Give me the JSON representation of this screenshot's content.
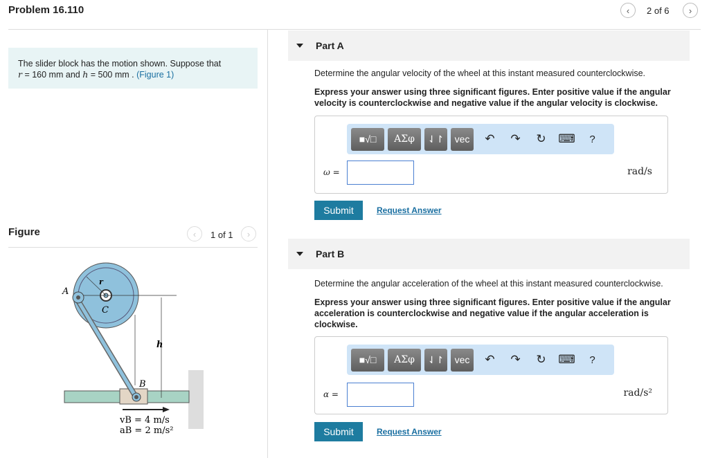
{
  "header": {
    "title": "Problem 16.110",
    "pager": "2 of 6",
    "prev_icon": "chevron-left-icon",
    "next_icon": "chevron-right-icon"
  },
  "problem": {
    "text_prefix": "The slider block has the motion shown. Suppose that",
    "r_var": "r",
    "r_val": " = 160  mm",
    "and": " and ",
    "h_var": "h",
    "h_val": " = 500  mm",
    "sep": " . ",
    "figure_link": "(Figure 1)"
  },
  "figure": {
    "label": "Figure",
    "pager": "1 of 1",
    "labels": {
      "A": "A",
      "C": "C",
      "r": "r",
      "h": "h",
      "B": "B",
      "vB": "vB = 4 m/s",
      "aB": "aB = 2 m/s²"
    }
  },
  "toolbar": {
    "templates": "■√□",
    "greek": "ΑΣφ",
    "arrows": "⇃↾",
    "vec": "vec",
    "undo": "↶",
    "redo": "↷",
    "reset": "↻",
    "keyboard": "⌨",
    "help": "?"
  },
  "parts": [
    {
      "label": "Part A",
      "question": "Determine the angular velocity of the wheel at this instant measured counterclockwise.",
      "instructions": "Express your answer using three significant figures. Enter positive value if the angular velocity is counterclockwise and negative value if the angular velocity is clockwise.",
      "var": "ω =",
      "value": "",
      "unit": "rad/s",
      "submit": "Submit",
      "request": "Request Answer"
    },
    {
      "label": "Part B",
      "question": "Determine the angular acceleration of the wheel at this instant measured counterclockwise.",
      "instructions": "Express your answer using three significant figures. Enter positive value if the angular acceleration is counterclockwise and negative value if the angular acceleration is clockwise.",
      "var": "α =",
      "value": "",
      "unit": "rad/s²",
      "submit": "Submit",
      "request": "Request Answer"
    }
  ],
  "colors": {
    "accent": "#1e7ca0",
    "toolbar": "#cfe4f7",
    "problem_bg": "#e8f4f5"
  }
}
